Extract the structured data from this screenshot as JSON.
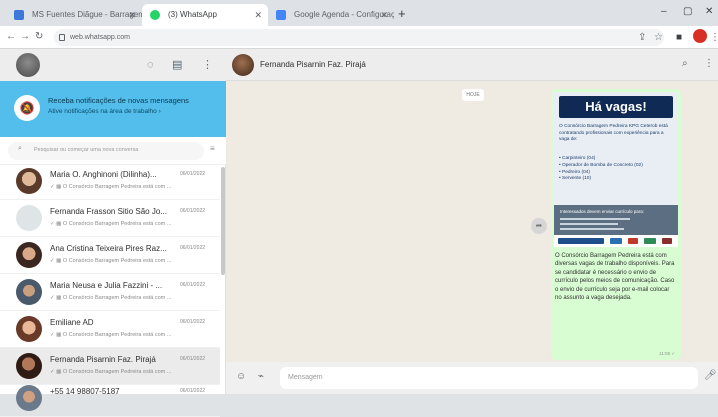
{
  "browser": {
    "tabs": [
      {
        "title": "MS Fuentes Diãgue - Barragem",
        "active": false
      },
      {
        "title": "(3) WhatsApp",
        "active": true
      },
      {
        "title": "Google Agenda - Configuração",
        "active": false
      }
    ],
    "new_tab": "+",
    "url": "web.whatsapp.com",
    "back": "←",
    "forward": "→",
    "reload": "↻",
    "minimize": "–",
    "maximize": "▢",
    "close": "✕"
  },
  "sidebar": {
    "notification": {
      "title": "Receba notificações de novas mensagens",
      "subtitle": "Ative notificações na área de trabalho ›"
    },
    "search_placeholder": "Pesquisar ou começar uma nova conversa",
    "chats": [
      {
        "name": "Maria O. Anghinoni (Dilinha)...",
        "date": "06/01/2022",
        "preview": "✓ ▦ O Consórcio Barragem Pedreira está com ..."
      },
      {
        "name": "Fernanda Frasson Sitio São Jo...",
        "date": "06/01/2022",
        "preview": "✓ ▦ O Consórcio Barragem Pedreira está com ..."
      },
      {
        "name": "Ana Cristina Teixeira Pires Raz...",
        "date": "06/01/2022",
        "preview": "✓ ▦ O Consórcio Barragem Pedreira está com ..."
      },
      {
        "name": "Maria Neusa e Julia Fazzini - ...",
        "date": "06/01/2022",
        "preview": "✓ ▦ O Consórcio Barragem Pedreira está com ..."
      },
      {
        "name": "Emiliane AD",
        "date": "06/01/2022",
        "preview": "✓ ▦ O Consórcio Barragem Pedreira está com ..."
      },
      {
        "name": "Fernanda Pisarnin Faz. Pirajá",
        "date": "06/01/2022",
        "preview": "✓ ▦ O Consórcio Barragem Pedreira está com ...",
        "selected": true
      },
      {
        "name": "+55 14 98807-5187",
        "date": "06/01/2022",
        "preview": ""
      }
    ]
  },
  "conversation": {
    "contact_name": "Fernanda Pisarnin Faz. Pirajá",
    "date_badge": "HOJE",
    "poster": {
      "headline": "Há vagas!",
      "intro": "O Consórcio Barragem Pedreira KPG Ceterob está contratando profissionais com experiência para a vaga de:",
      "jobs": [
        "• Carpinteiro (04)",
        "• Operador de Bomba de Concreto (02)",
        "• Pedreiro (04)",
        "• Servente (10)"
      ],
      "band_title": "Interessados devem enviar currículo para:"
    },
    "message_text": "O Consórcio Barragem Pedreira está com diversas vagas de trabalho disponíveis. Para se candidatar é necessário o envio de currículo pelos meios de comunicação. Caso o envio de currículo seja por e-mail colocar no assunto a vaga desejada.",
    "message_time": "11:08 ✓",
    "composer_placeholder": "Mensagem"
  }
}
